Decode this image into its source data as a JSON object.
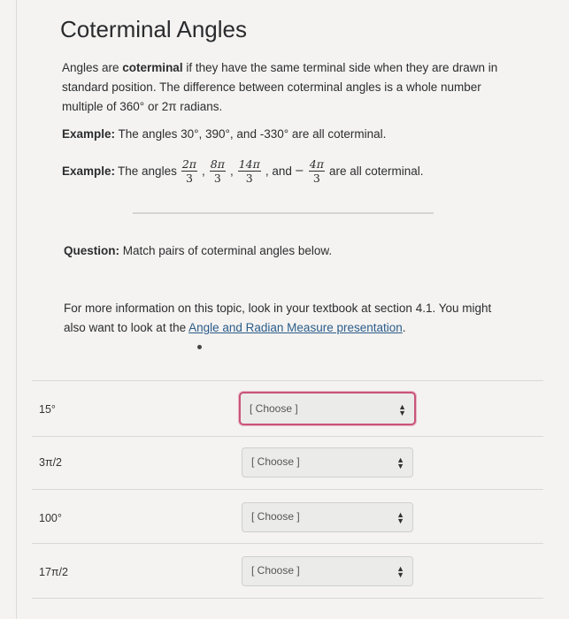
{
  "title": "Coterminal Angles",
  "intro": {
    "before": "Angles are ",
    "bold": "coterminal",
    "after": " if they have the same terminal side when they are drawn in standard position. The difference between coterminal angles is a whole number multiple of 360° or 2π radians."
  },
  "example1": {
    "label": "Example:",
    "text": " The angles 30°, 390°, and -330° are all coterminal."
  },
  "example2": {
    "label": "Example:",
    "lead": " The angles",
    "fractions": [
      {
        "num": "2π",
        "den": "3"
      },
      {
        "num": "8π",
        "den": "3"
      },
      {
        "num": "14π",
        "den": "3"
      },
      {
        "num": "4π",
        "den": "3"
      }
    ],
    "and_text": ", and",
    "neg": "−",
    "tail": "are all coterminal."
  },
  "question": {
    "label": "Question:",
    "text": " Match pairs of coterminal angles below."
  },
  "info": {
    "text": "For more information on this topic, look in your textbook at section 4.1. You might also want to look at the ",
    "link": "Angle and Radian Measure presentation",
    "end": "."
  },
  "rows": [
    {
      "label": "15°",
      "select": "[ Choose ]"
    },
    {
      "label": "3π/2",
      "select": "[ Choose ]"
    },
    {
      "label": "100°",
      "select": "[ Choose ]"
    },
    {
      "label": "17π/2",
      "select": "[ Choose ]"
    }
  ]
}
